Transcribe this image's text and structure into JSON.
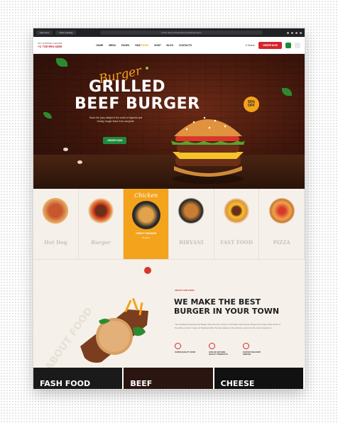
{
  "browser": {
    "tab1": "Fatz store",
    "tab2": "Order tracking",
    "url": "ISTC/ themes.fifteenthemes/fazfood-demo"
  },
  "header": {
    "support_label": "24/7 SUPPORT CENTER",
    "phone": "+1 718-904-4450",
    "nav": [
      "HOME",
      "MENU",
      "PAGES",
      "SHOP",
      "BLOG",
      "CONTACTS"
    ],
    "logo_main": "FAZ",
    "logo_accent": "FOOD",
    "search_label": "Search",
    "order_label": "ORDER NOW"
  },
  "hero": {
    "script": "Burger",
    "title_line1": "GRILLED",
    "title_line2": "BEEF BURGER",
    "description": "Savor the juicy delight in the world of legends and Smoky burger feast in its complete.",
    "cta": "ORDER NOW",
    "badge_value": "50%",
    "badge_text": "OFF"
  },
  "categories": [
    {
      "name": "Hot Dog",
      "active": false
    },
    {
      "name": "Burger",
      "active": false
    },
    {
      "name": "Chicken",
      "label": "CRISPY CHICKEN",
      "sub": "35 Items",
      "active": true
    },
    {
      "name": "BIRYANI",
      "active": false
    },
    {
      "name": "FAST FOOD",
      "active": false
    },
    {
      "name": "PIZZA",
      "active": false
    }
  ],
  "about": {
    "watermark": "ABOUT FOOD",
    "eyebrow": "ABOUT OUR FOOD",
    "heading_line1": "WE MAKE THE BEST",
    "heading_line2": "BURGER IN YOUR TOWN",
    "paragraph": "The restaurant became the Burger brand for the variety of Vermilion Farmhouse Burger and many other kinds of the delivery food. A team of Fastfood offer the best places in the delivery, serve for the most customers.",
    "features": [
      "SUPER QUALITY FOOD",
      "100% OF NATURAL QUALITY PRODUCTS",
      "FASTEST DELIVERY SERVICE"
    ]
  },
  "tiles": [
    "FASH FOOD",
    "BEEF",
    "CHEESE"
  ],
  "colors": {
    "brand_red": "#d3262a",
    "accent_yellow": "#f3a31c",
    "cta_green": "#1f8a3e"
  }
}
